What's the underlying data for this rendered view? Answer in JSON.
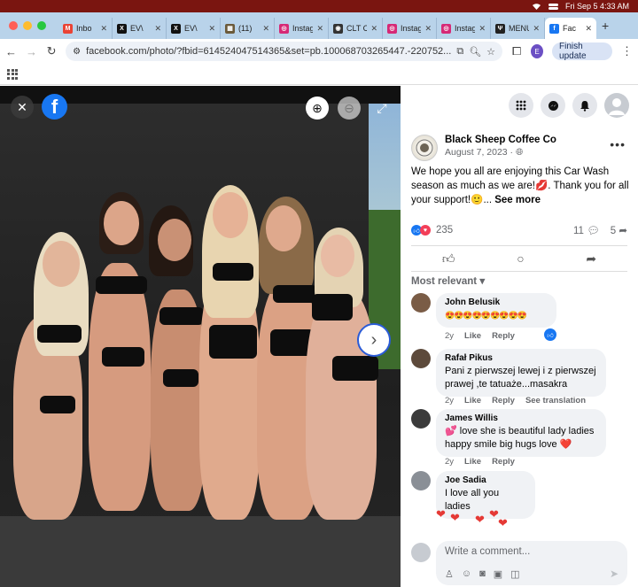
{
  "menubar": {
    "datetime": "Fri Sep 5  4:33 AM"
  },
  "tabs": [
    {
      "label": "Inbo",
      "icon": "gmail-icon",
      "color": "#ea4335",
      "glyph": "M"
    },
    {
      "label": "EV\\",
      "icon": "x-icon",
      "color": "#111111",
      "glyph": "X"
    },
    {
      "label": "EV\\",
      "icon": "x-icon",
      "color": "#111111",
      "glyph": "X"
    },
    {
      "label": "(11)",
      "icon": "image-icon",
      "color": "#6b5a3a",
      "glyph": "▦"
    },
    {
      "label": "Instagr",
      "icon": "instagram-icon",
      "color": "#d62976",
      "glyph": "◎"
    },
    {
      "label": "CLT CO",
      "icon": "clt-icon",
      "color": "#333333",
      "glyph": "◉"
    },
    {
      "label": "Instagr",
      "icon": "instagram-icon",
      "color": "#d62976",
      "glyph": "◎"
    },
    {
      "label": "Instagr",
      "icon": "instagram-icon",
      "color": "#d62976",
      "glyph": "◎"
    },
    {
      "label": "MENU",
      "icon": "menu-icon",
      "color": "#222222",
      "glyph": "Ψ"
    },
    {
      "label": "Fac",
      "icon": "facebook-icon",
      "color": "#1877f2",
      "glyph": "f",
      "active": true
    }
  ],
  "address": {
    "url": "facebook.com/photo/?fbid=614524047514365&set=pb.100068703265447.-220752...",
    "finish_label": "Finish update",
    "profile_letter": "E"
  },
  "post": {
    "page_name": "Black Sheep Coffee Co",
    "date": "August 7, 2023 · ",
    "text_main": "We hope you all are enjoying this Car Wash season as much as we are!💋. Thank you for all your support!🙂... ",
    "see_more": "See more",
    "reaction_count": "235",
    "comment_count": "11",
    "share_count": "5"
  },
  "sort_label": "Most relevant",
  "comments": [
    {
      "name": "John Belusik",
      "text": "😍😍😍😍😍😍😍😍😍",
      "time": "2y",
      "like": "Like",
      "reply": "Reply",
      "avatar_color": "#7a5c46"
    },
    {
      "name": "Rafał Pikus",
      "text": "Pani z pierwszej lewej i z pierwszej prawej ,te tatuaże...masakra",
      "time": "2y",
      "like": "Like",
      "reply": "Reply",
      "extra": "See translation",
      "avatar_color": "#5d4a3b"
    },
    {
      "name": "James Willis",
      "text": "💕 love she is beautiful lady ladies happy smile big hugs love ❤️",
      "time": "2y",
      "like": "Like",
      "reply": "Reply",
      "avatar_color": "#3b3b3b"
    },
    {
      "name": "Joe Sadia",
      "text": "I love all you ladies",
      "avatar_color": "#8a8f96"
    }
  ],
  "composer": {
    "placeholder": "Write a comment..."
  }
}
